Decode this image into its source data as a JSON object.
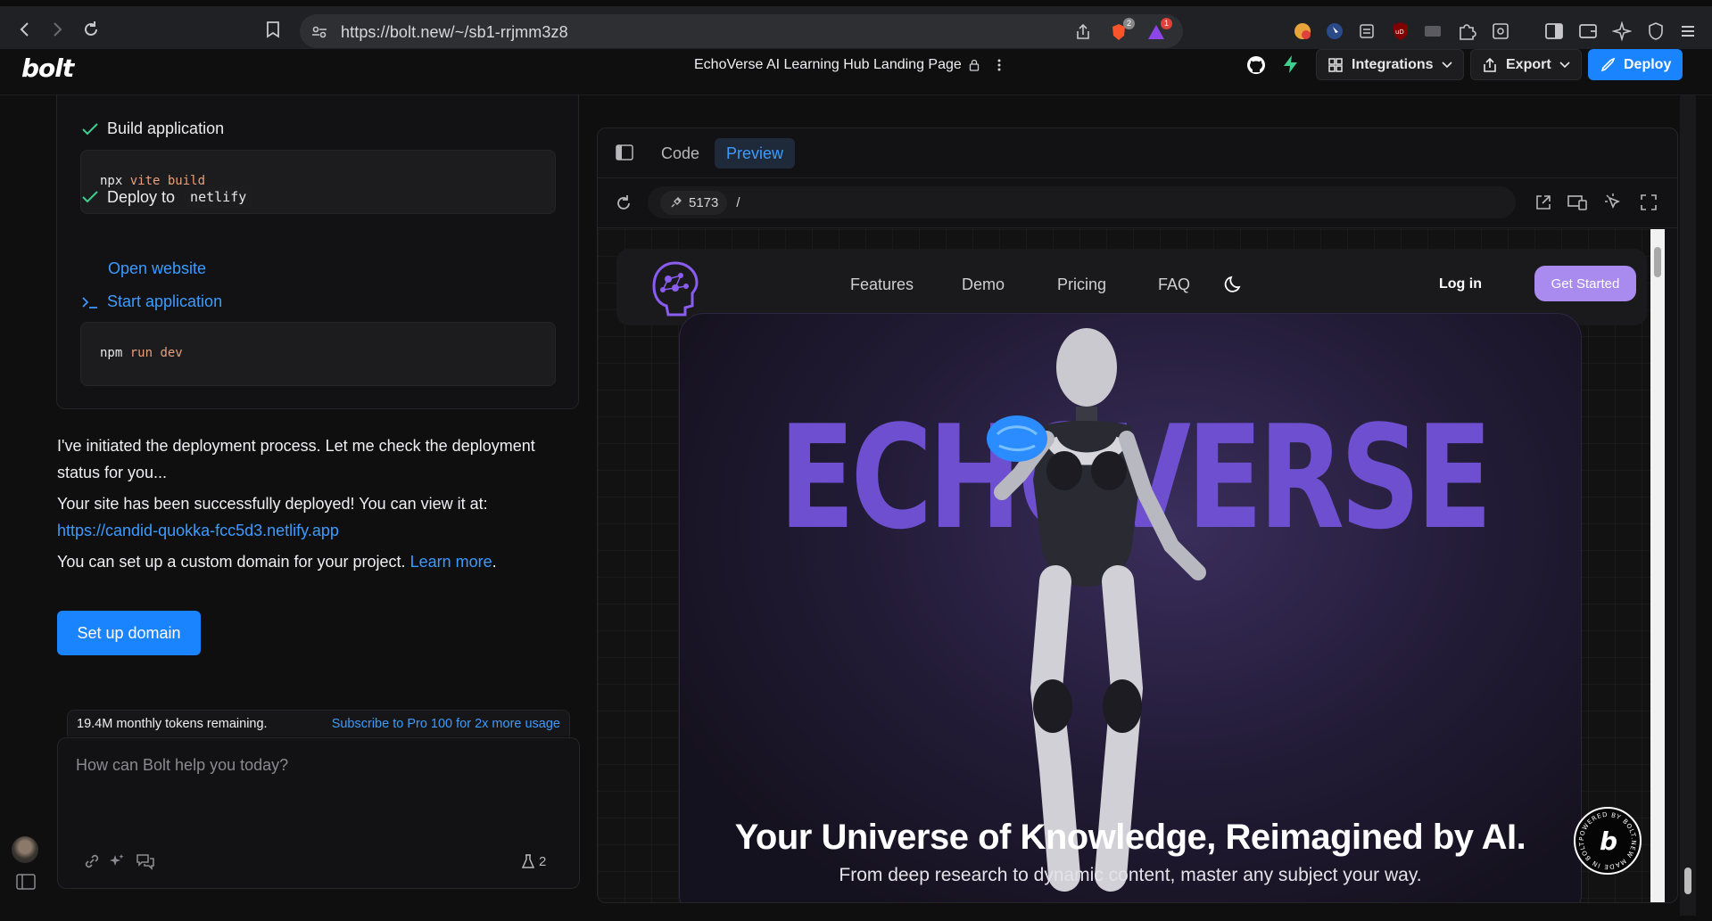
{
  "browser": {
    "url": "https://bolt.new/~/sb1-rrjmm3z8",
    "brave_badge": "2",
    "alert_badge": "1"
  },
  "header": {
    "logo": "bolt",
    "project_title": "EchoVerse AI Learning Hub Landing Page",
    "integrations_label": "Integrations",
    "export_label": "Export",
    "deploy_label": "Deploy"
  },
  "chat": {
    "steps": [
      {
        "label": "Build application",
        "command": "npx",
        "args": "vite build"
      },
      {
        "label": "Deploy to",
        "target": "netlify",
        "link": "Open website"
      },
      {
        "label": "Start application",
        "command": "npm",
        "args": "run dev"
      }
    ],
    "message1": "I've initiated the deployment process. Let me check the deployment status for you...",
    "message2": "Your site has been successfully deployed! You can view it at:",
    "deployed_url": "https://candid-quokka-fcc5d3.netlify.app",
    "message3_prefix": "You can set up a custom domain for your project.",
    "learn_more": "Learn more",
    "message3_suffix": ".",
    "setup_domain_label": "Set up domain",
    "tokens_remaining": "19.4M monthly tokens remaining.",
    "subscribe_label": "Subscribe to Pro 100 for 2x more usage",
    "prompt_placeholder": "How can Bolt help you today?",
    "lab_count": "2"
  },
  "preview": {
    "tabs": [
      {
        "label": "Code",
        "active": false
      },
      {
        "label": "Preview",
        "active": true
      }
    ],
    "port": "5173",
    "path": "/"
  },
  "site": {
    "nav": [
      "Features",
      "Demo",
      "Pricing",
      "FAQ"
    ],
    "login": "Log in",
    "get_started": "Get Started",
    "hero_word": "ECHOVERSE",
    "hero_title": "Your Universe of Knowledge, Reimagined by AI.",
    "hero_subtitle": "From deep research to dynamic content, master any subject your way.",
    "stamp_text": "POWERED BY BOLT.NEW MADE IN BOLT.NEW",
    "stamp_letter": "b"
  },
  "colors": {
    "accent": "#1a84ff",
    "link": "#3d9bff",
    "hero_purple": "#6e4fd0",
    "get_started": "#a98bf0"
  }
}
